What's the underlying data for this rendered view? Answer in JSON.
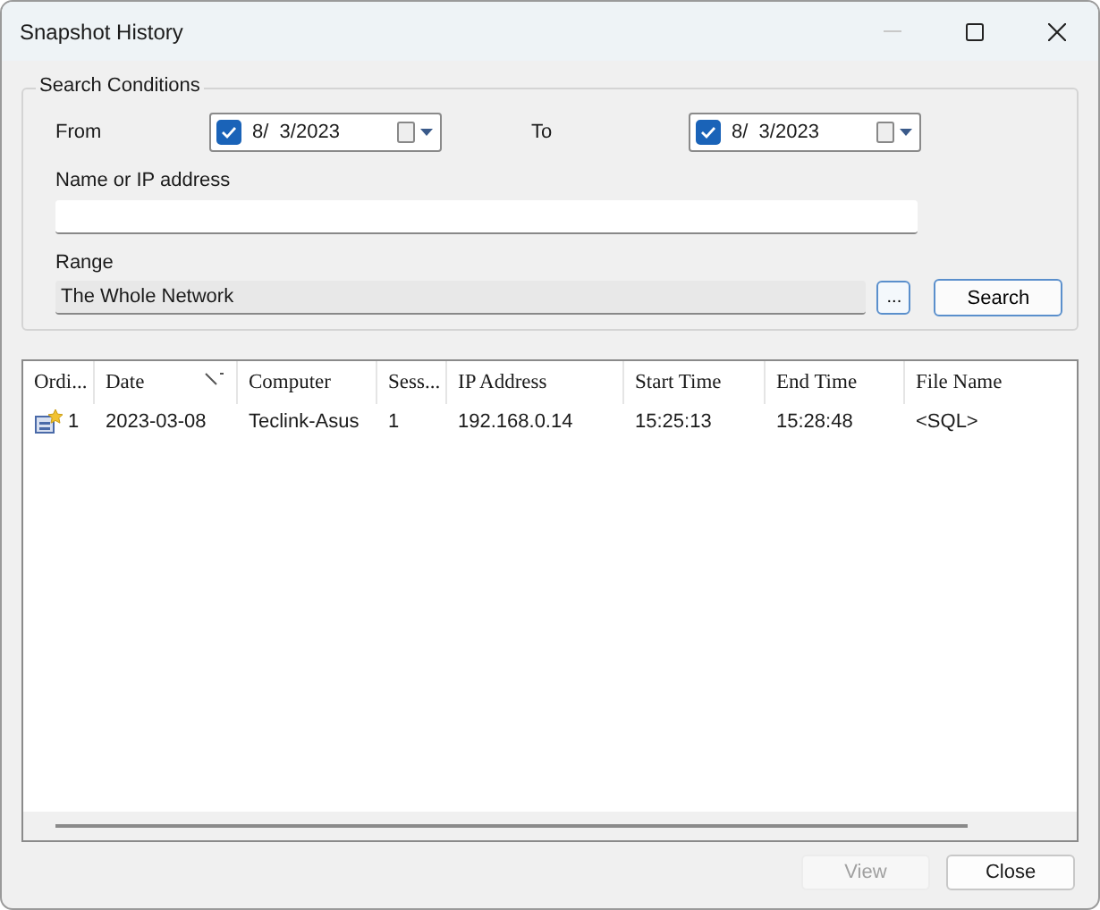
{
  "window": {
    "title": "Snapshot History"
  },
  "search_conditions": {
    "title": "Search Conditions",
    "from": {
      "label": "From",
      "checked": true,
      "date": "8/  3/2023"
    },
    "to": {
      "label": "To",
      "checked": true,
      "date": "8/  3/2023"
    },
    "name_field": {
      "label": "Name or IP address"
    },
    "range": {
      "label": "Range",
      "value": "The Whole Network",
      "browse": "...",
      "search": "Search"
    }
  },
  "table": {
    "columns": [
      {
        "label": "Ordi...",
        "sorted": false
      },
      {
        "label": "Date",
        "sorted": true
      },
      {
        "label": "Computer",
        "sorted": false
      },
      {
        "label": "Sess...",
        "sorted": false
      },
      {
        "label": "IP Address",
        "sorted": false
      },
      {
        "label": "Start Time",
        "sorted": false
      },
      {
        "label": "End Time",
        "sorted": false
      },
      {
        "label": "File Name",
        "sorted": false
      }
    ],
    "rows": [
      {
        "cells": [
          "1",
          "2023-03-08",
          "Teclink-Asus",
          "1",
          "192.168.0.14",
          "15:25:13",
          "15:28:48",
          "<SQL>"
        ]
      }
    ]
  },
  "buttons": [
    {
      "label": "View",
      "disabled": true
    },
    {
      "label": "Close",
      "disabled": false
    }
  ]
}
